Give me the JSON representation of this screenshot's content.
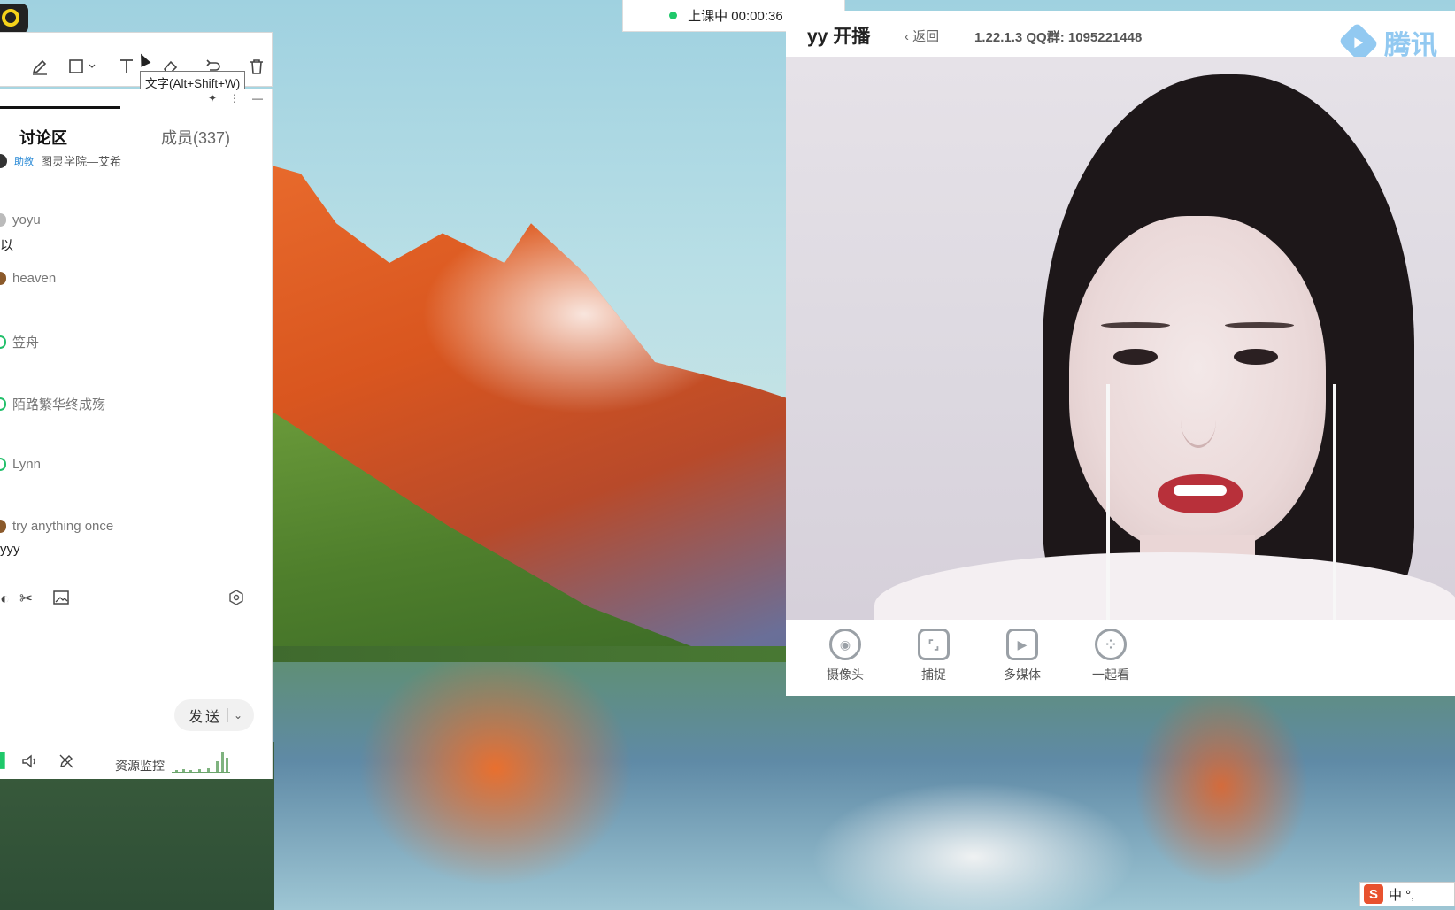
{
  "toolbar": {
    "minimize": "—",
    "tooltip": "文字(Alt+Shift+W)"
  },
  "chat": {
    "tab_discussion": "讨论区",
    "tab_members": "成员(337)",
    "pinned_badge": "助教",
    "pinned_name": "图灵学院—艾希",
    "messages": [
      {
        "name": "yoyu",
        "text": "以"
      },
      {
        "name": "heaven",
        "text": ""
      },
      {
        "name": "笠舟",
        "text": ""
      },
      {
        "name": "陌路繁华终成殇",
        "text": ""
      },
      {
        "name": "Lynn",
        "text": ""
      },
      {
        "name": "try anything once",
        "text": "yyy"
      }
    ],
    "send_label": "发送",
    "monitor_label": "资源监控"
  },
  "timer": {
    "label": "上课中 00:00:36"
  },
  "stream": {
    "logo": "yy 开播",
    "back_label": "返回",
    "version_info": "1.22.1.3  QQ群: 1095221448",
    "brand_text": "腾讯",
    "tools": [
      {
        "label": "摄像头",
        "icon": "camera-icon"
      },
      {
        "label": "捕捉",
        "icon": "capture-icon"
      },
      {
        "label": "多媒体",
        "icon": "play-icon"
      },
      {
        "label": "一起看",
        "icon": "film-reel-icon"
      }
    ]
  },
  "ime": {
    "logo": "S",
    "text": "中 °,"
  },
  "colors": {
    "live_green": "#1fc86a",
    "link_blue": "#2a8ad6",
    "brand_blue": "#4aa6e8",
    "ime_orange": "#e8522f"
  }
}
